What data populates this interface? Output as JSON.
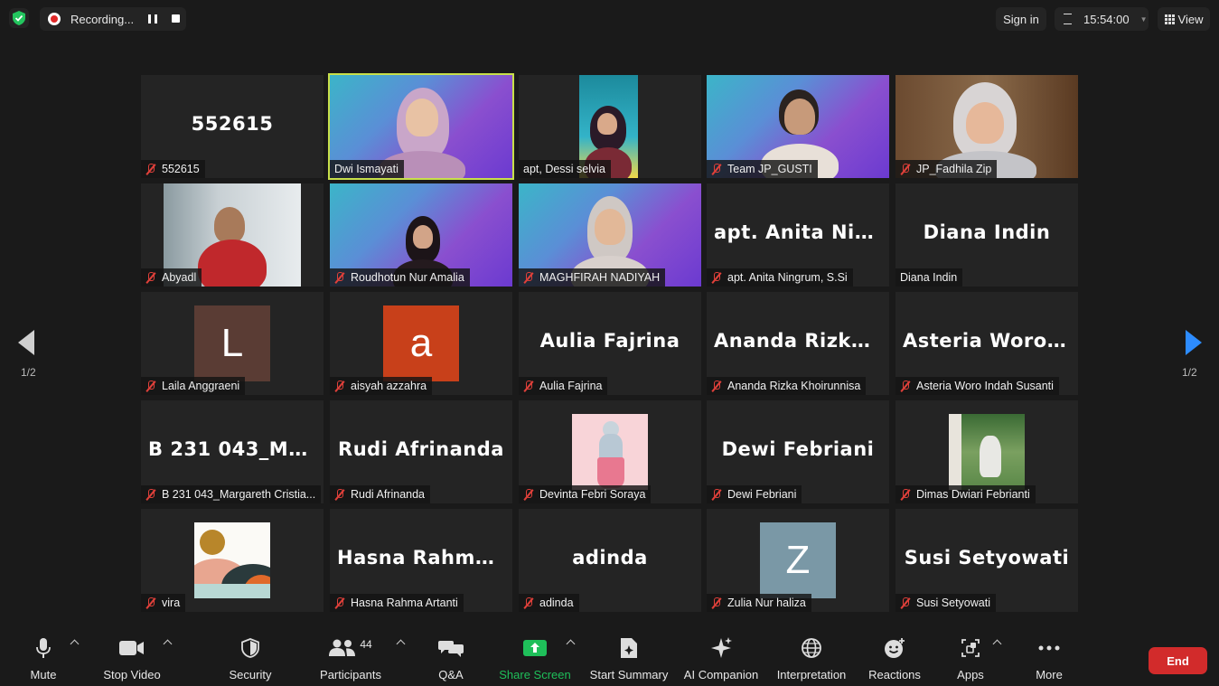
{
  "topbar": {
    "recording_label": "Recording...",
    "signin_label": "Sign in",
    "timer": "15:54:00",
    "view_label": "View"
  },
  "gallery": {
    "page_left": "1/2",
    "page_right": "1/2",
    "tiles": [
      {
        "big": "552615",
        "name": "552615"
      },
      {
        "big": "",
        "name": "Dwi Ismayati"
      },
      {
        "big": "",
        "name": "apt, Dessi selvia"
      },
      {
        "big": "",
        "name": "Team JP_GUSTI"
      },
      {
        "big": "",
        "name": "JP_Fadhila Zip"
      },
      {
        "big": "",
        "name": "Abyadl"
      },
      {
        "big": "",
        "name": "Roudhotun Nur Amalia"
      },
      {
        "big": "",
        "name": "MAGHFIRAH NADIYAH"
      },
      {
        "big": "apt. Anita Ning...",
        "name": "apt. Anita Ningrum, S.Si"
      },
      {
        "big": "Diana Indin",
        "name": "Diana Indin"
      },
      {
        "big": "",
        "name": "Laila Anggraeni",
        "avatar_letter": "L"
      },
      {
        "big": "",
        "name": "aisyah azzahra",
        "avatar_letter": "a"
      },
      {
        "big": "Aulia Fajrina",
        "name": "Aulia Fajrina"
      },
      {
        "big": "Ananda Rizka K...",
        "name": "Ananda Rizka Khoirunnisa"
      },
      {
        "big": "Asteria Woro In...",
        "name": "Asteria Woro Indah Susanti"
      },
      {
        "big": "B 231 043_Mar...",
        "name": "B 231 043_Margareth Cristia..."
      },
      {
        "big": "Rudi Afrinanda",
        "name": "Rudi Afrinanda"
      },
      {
        "big": "",
        "name": "Devinta Febri Soraya"
      },
      {
        "big": "Dewi Febriani",
        "name": "Dewi Febriani"
      },
      {
        "big": "",
        "name": "Dimas Dwiari Febrianti"
      },
      {
        "big": "",
        "name": "vira"
      },
      {
        "big": "Hasna Rahma A...",
        "name": "Hasna Rahma Artanti"
      },
      {
        "big": "adinda",
        "name": "adinda"
      },
      {
        "big": "",
        "name": "Zulia Nur haliza",
        "avatar_letter": "Z"
      },
      {
        "big": "Susi Setyowati",
        "name": "Susi Setyowati"
      }
    ]
  },
  "toolbar": {
    "mute": "Mute",
    "stop_video": "Stop Video",
    "security": "Security",
    "participants": "Participants",
    "participants_count": "44",
    "qa": "Q&A",
    "share_screen": "Share Screen",
    "start_summary": "Start Summary",
    "ai_companion": "AI Companion",
    "interpretation": "Interpretation",
    "reactions": "Reactions",
    "apps": "Apps",
    "more": "More",
    "end": "End"
  },
  "colors": {
    "active_speaker_border": "#c8e04a",
    "share_green": "#1fbf5a",
    "end_red": "#d22b2b",
    "nav_arrow_blue": "#2d8cff"
  }
}
